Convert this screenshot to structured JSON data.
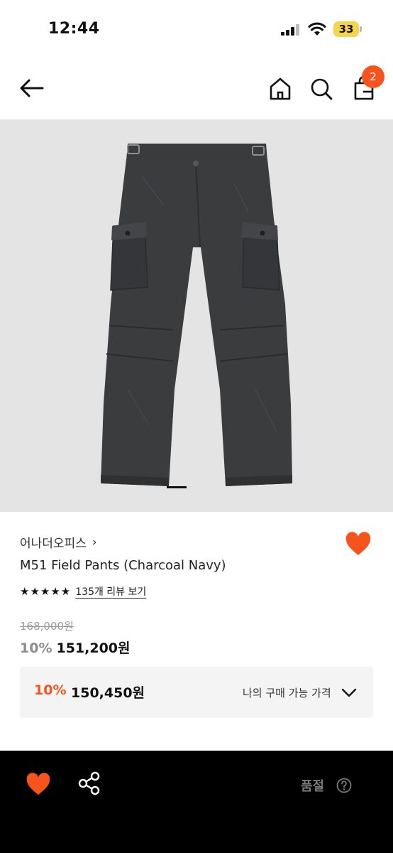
{
  "status_bar": {
    "time": "12:44",
    "battery": "33"
  },
  "header": {
    "cart_count": "2"
  },
  "product": {
    "brand": "어나더오피스",
    "brand_chevron": "›",
    "name": "M51 Field Pants (Charcoal Navy)",
    "rating_stars": "★★★★★",
    "reviews_link": "135개 리뷰 보기",
    "original_price": "168,000원",
    "sale_discount": "10%",
    "sale_price": "151,200원",
    "my_price": {
      "discount": "10%",
      "price": "150,450원",
      "label": "나의 구매 가능 가격"
    }
  },
  "bottom_bar": {
    "status": "품절"
  },
  "colors": {
    "accent": "#f7541d",
    "image_bg": "#e4e4e4",
    "pants": "#3b3c3e"
  },
  "icons": [
    "back-arrow-icon",
    "home-icon",
    "search-icon",
    "shopping-bag-icon",
    "heart-icon",
    "share-icon",
    "chevron-down-icon",
    "help-icon"
  ]
}
